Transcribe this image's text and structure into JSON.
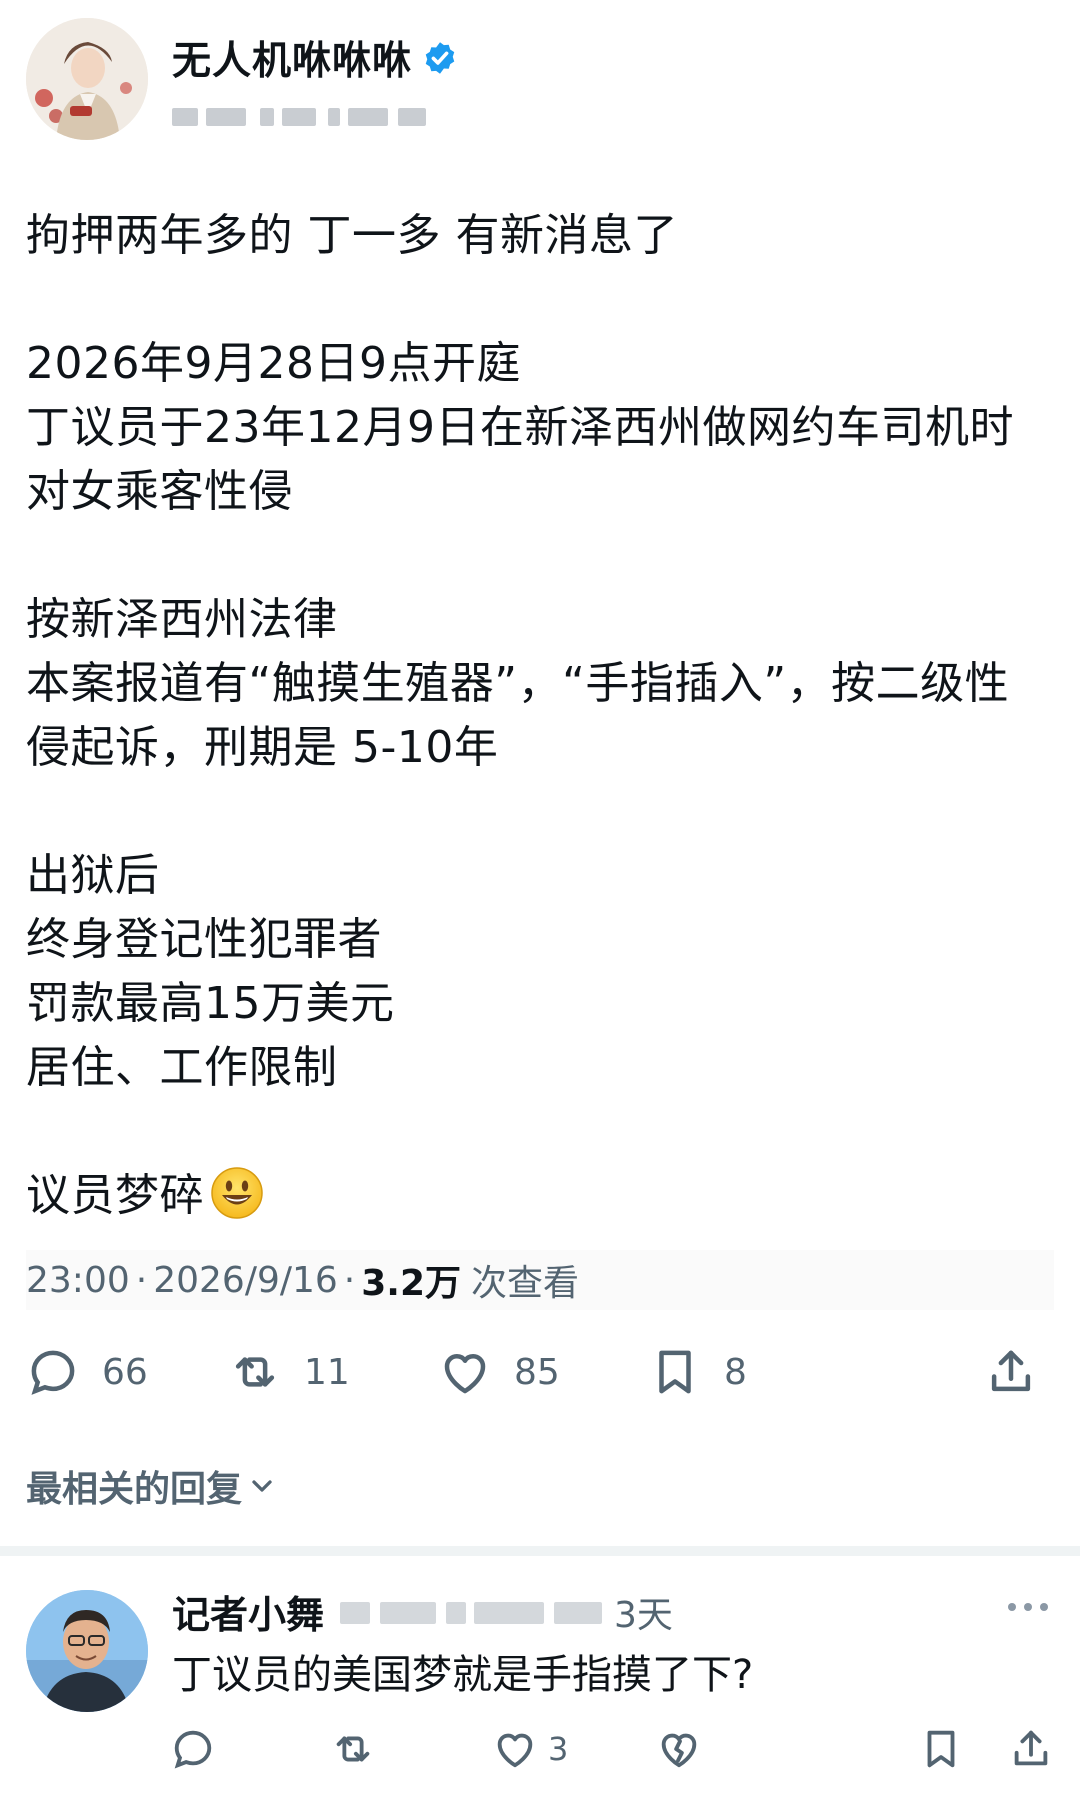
{
  "post": {
    "author_name": "无人机咻咻咻",
    "body": {
      "line1": "拘押两年多的 丁一多 有新消息了",
      "line2": "2026年9月28日9点开庭",
      "line3": "丁议员于23年12月9日在新泽西州做网约车司机时",
      "line4": "对女乘客性侵",
      "line5": "按新泽西州法律",
      "line6": "本案报道有“触摸生殖器”，“手指插入”，按二级性",
      "line7": "侵起诉，刑期是 5-10年",
      "line8": "出狱后",
      "line9": "终身登记性犯罪者",
      "line10": "罚款最高15万美元",
      "line11": "居住、工作限制",
      "line12": "议员梦碎"
    },
    "time": "23:00",
    "date": "2026/9/16",
    "separator": "·",
    "views_count": "3.2万",
    "views_label": "次查看",
    "stats": {
      "replies": "66",
      "reposts": "11",
      "likes": "85",
      "bookmarks": "8"
    }
  },
  "replies_section": {
    "sort_label": "最相关的回复"
  },
  "reply": {
    "author_name": "记者小舞",
    "time": "3天",
    "text": "丁议员的美国梦就是手指摸了下?",
    "likes": "3"
  },
  "colors": {
    "verified": "#1d9bf0",
    "text_primary": "#0f1419",
    "text_secondary": "#536471",
    "divider": "#eff3f4"
  }
}
